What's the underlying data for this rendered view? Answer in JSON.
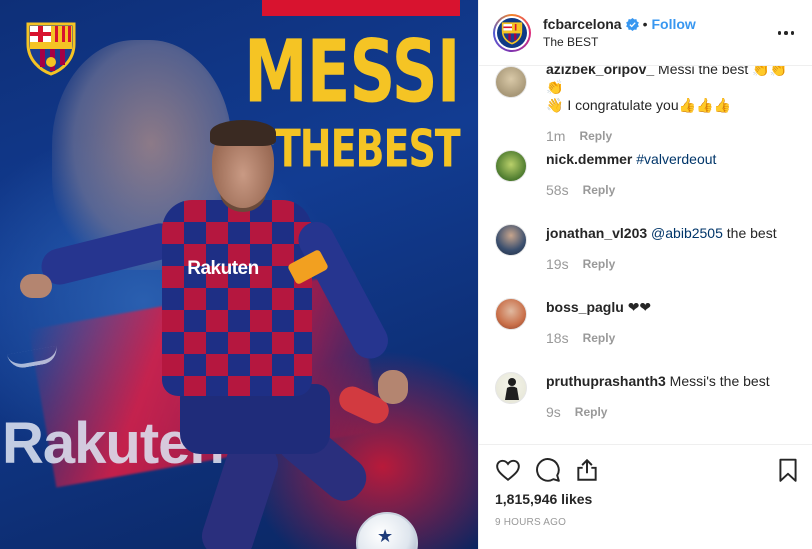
{
  "media": {
    "headline_line1": "MESSI",
    "headline_line2": "#THEBEST",
    "shirt_sponsor": "Rakuten",
    "background_sponsor": "Rakuten",
    "crest_text": "FCB",
    "colors": {
      "headline": "#f5c424",
      "blue": "#123c92",
      "red": "#d8132f"
    }
  },
  "header": {
    "username": "fcbarcelona",
    "separator": "•",
    "follow_label": "Follow",
    "location": "The BEST",
    "verified_icon": "verified-badge-icon",
    "more_icon": "more-options-icon"
  },
  "comments": [
    {
      "user": "azizbek_oripov_",
      "text": "Messi the best 👏👏👏",
      "text2": "👋 I congratulate you👍👍👍",
      "time": "1m",
      "reply": "Reply"
    },
    {
      "user": "nick.demmer",
      "mention": "#valverdeout",
      "text": "",
      "time": "58s",
      "reply": "Reply"
    },
    {
      "user": "jonathan_vl203",
      "mention": "@abib2505",
      "text": " the best",
      "time": "19s",
      "reply": "Reply"
    },
    {
      "user": "boss_paglu",
      "text": "❤❤",
      "time": "18s",
      "reply": "Reply"
    },
    {
      "user": "pruthuprashanth3",
      "text": "Messi's the best",
      "time": "9s",
      "reply": "Reply"
    }
  ],
  "actions": {
    "like_icon": "heart-icon",
    "comment_icon": "comment-icon",
    "share_icon": "share-icon",
    "save_icon": "bookmark-icon",
    "likes": "1,815,946 likes",
    "time_ago": "9 HOURS AGO"
  },
  "colors": {
    "link": "#3897f0",
    "mention": "#003569",
    "muted": "#999999",
    "text": "#262626"
  }
}
